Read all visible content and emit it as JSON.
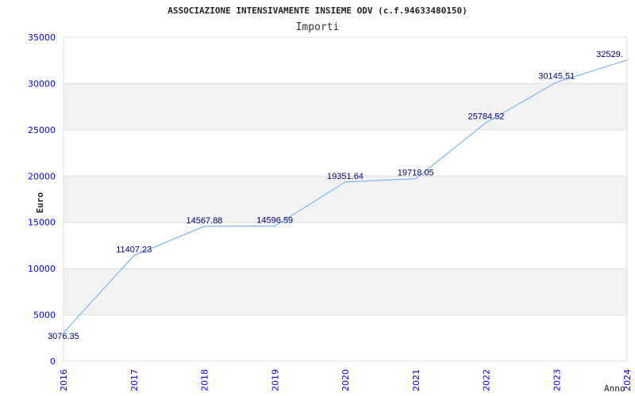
{
  "chart_data": {
    "type": "line",
    "title": "ASSOCIAZIONE INTENSIVAMENTE INSIEME ODV (c.f.94633480150)",
    "subtitle": "Importi",
    "xlabel": "Anno",
    "ylabel": "Euro",
    "x": [
      "2016",
      "2017",
      "2018",
      "2019",
      "2020",
      "2021",
      "2022",
      "2023",
      "2024"
    ],
    "values": [
      3076.35,
      11407.23,
      14567.88,
      14596.59,
      19351.64,
      19718.05,
      25784.52,
      30145.51,
      32529
    ],
    "data_labels": [
      "3076.35",
      "11407.23",
      "14567.88",
      "14596.59",
      "19351.64",
      "19718.05",
      "25784.52",
      "30145.51",
      "32529."
    ],
    "ylim": [
      0,
      35000
    ],
    "yticks": [
      "0",
      "5000",
      "10000",
      "15000",
      "20000",
      "25000",
      "30000",
      "35000"
    ],
    "grid": "alternating horizontal bands",
    "colors": {
      "line": "#66aaff",
      "tick": "#0000ff",
      "label": "#000080",
      "band": "#f3f3f3"
    }
  }
}
